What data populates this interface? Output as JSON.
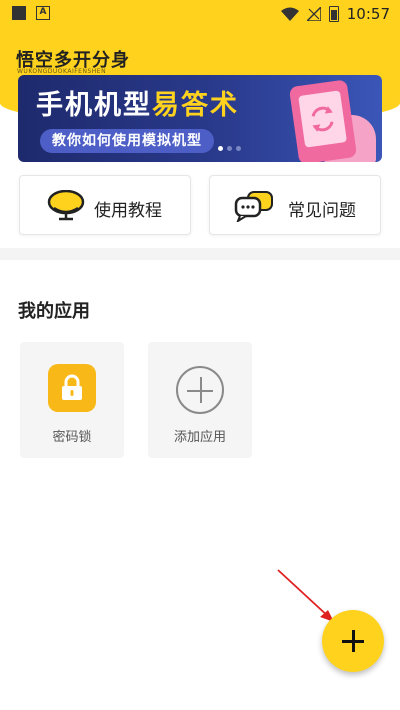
{
  "status_bar": {
    "time": "10:57",
    "left_badge": "A"
  },
  "header": {
    "title": "悟空多开分身",
    "subtitle": "WUKONGDUOKAIFENSHEN"
  },
  "banner": {
    "title_main": "手机机型",
    "title_highlight": "易答术",
    "subtitle": "教你如何使用模拟机型"
  },
  "quick_actions": [
    {
      "label": "使用教程",
      "icon": "tutorial-monitor-icon"
    },
    {
      "label": "常见问题",
      "icon": "faq-chat-icon"
    }
  ],
  "my_apps": {
    "title": "我的应用",
    "items": [
      {
        "label": "密码锁",
        "icon": "lock-icon"
      },
      {
        "label": "添加应用",
        "icon": "add-circle-icon"
      }
    ]
  },
  "fab": {
    "icon": "plus-icon"
  },
  "colors": {
    "accent": "#ffd21e",
    "banner_bg": "#1e2a6d",
    "lock_bg": "#f7b818",
    "arrow": "#e02020"
  }
}
